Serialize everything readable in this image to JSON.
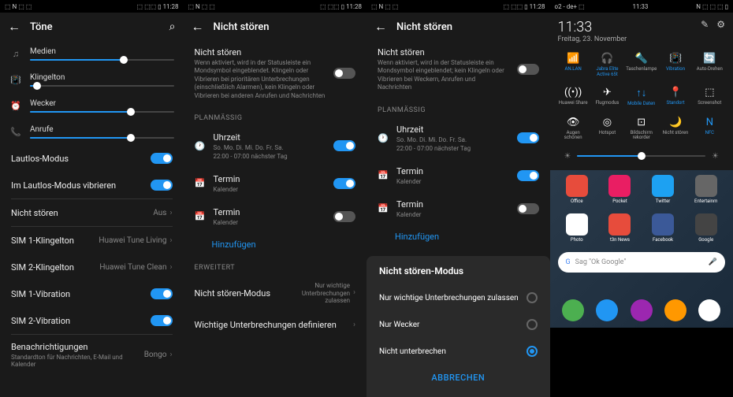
{
  "statusbar": {
    "time": "11:28",
    "left_icons": "⬚ N ⬚ ⬚",
    "right_icons": "⬚ ⬚⬚ ▯"
  },
  "s1": {
    "title": "Töne",
    "sliders": [
      {
        "icon": "♫",
        "label": "Medien",
        "value": 65
      },
      {
        "icon": "📳",
        "label": "Klingelton",
        "value": 5
      },
      {
        "icon": "⏰",
        "label": "Wecker",
        "value": 70
      },
      {
        "icon": "📞",
        "label": "Anrufe",
        "value": 70
      }
    ],
    "rows": [
      {
        "label": "Lautlos-Modus",
        "toggle": true
      },
      {
        "label": "Im Lautlos-Modus vibrieren",
        "toggle": true
      }
    ],
    "dnd": {
      "label": "Nicht stören",
      "value": "Aus"
    },
    "sim_rows": [
      {
        "label": "SIM 1-Klingelton",
        "value": "Huawei Tune Living"
      },
      {
        "label": "SIM 2-Klingelton",
        "value": "Huawei Tune Clean"
      },
      {
        "label": "SIM 1-Vibration",
        "toggle": true
      },
      {
        "label": "SIM 2-Vibration",
        "toggle": true
      }
    ],
    "notif": {
      "label": "Benachrichtigungen",
      "sub": "Standardton für Nachrichten, E-Mail und Kalender",
      "value": "Bongo"
    }
  },
  "s2": {
    "title": "Nicht stören",
    "desc": {
      "title": "Nicht stören",
      "text": "Wenn aktiviert, wird in der Statusleiste ein Mondsymbol eingeblendet. Klingeln oder Vibrieren bei prioritären Unterbrechungen (einschließlich Alarmen), kein Klingeln oder Vibrieren bei anderen Anrufen und Nachrichten"
    },
    "sect_plan": "PLANMÄSSIG",
    "time_row": {
      "label": "Uhrzeit",
      "sub": "So. Mo. Di. Mi. Do. Fr. Sa.",
      "sub2": "22:00 - 07:00 nächster Tag",
      "toggle": true
    },
    "termin1": {
      "label": "Termin",
      "sub": "Kalender",
      "toggle": true
    },
    "termin2": {
      "label": "Termin",
      "sub": "Kalender",
      "toggle": false
    },
    "add": "Hinzufügen",
    "sect_adv": "ERWEITERT",
    "mode": {
      "label": "Nicht stören-Modus",
      "value": "Nur wichtige Unterbrechungen zulassen"
    },
    "define": "Wichtige Unterbrechungen definieren"
  },
  "s3": {
    "title": "Nicht stören",
    "desc": {
      "title": "Nicht stören",
      "text": "Wenn aktiviert, wird in der Statusleiste ein Mondsymbol eingeblendet; kein Klingeln oder Vibrieren bei Weckern, Anrufen und Nachrichten"
    },
    "sect_plan": "PLANMÄSSIG",
    "time_row": {
      "label": "Uhrzeit",
      "sub": "So. Mo. Di. Mi. Do. Fr. Sa.",
      "sub2": "22:00 - 07:00 nächster Tag",
      "toggle": true
    },
    "termin1": {
      "label": "Termin",
      "sub": "Kalender",
      "toggle": true
    },
    "termin2": {
      "label": "Termin",
      "sub": "Kalender",
      "toggle": false
    },
    "add": "Hinzufügen",
    "dialog": {
      "title": "Nicht stören-Modus",
      "opts": [
        {
          "label": "Nur wichtige Unterbrechungen zulassen",
          "sel": false
        },
        {
          "label": "Nur Wecker",
          "sel": false
        },
        {
          "label": "Nicht unterbrechen",
          "sel": true
        }
      ],
      "cancel": "ABBRECHEN"
    }
  },
  "s4": {
    "statusbar": {
      "left": "o2 - de+ ⬚",
      "time": "11:33",
      "right": "N ⬚ ⬚ ⬚ ▯"
    },
    "time": "11:33",
    "date": "Freitag, 23. November",
    "tiles": [
      {
        "ic": "📶",
        "lbl": "AN.LAN",
        "active": true
      },
      {
        "ic": "🎧",
        "lbl": "Jabra Elite Active 65t",
        "active": true
      },
      {
        "ic": "🔦",
        "lbl": "Taschenlampe",
        "active": false
      },
      {
        "ic": "📳",
        "lbl": "Vibration",
        "active": true
      },
      {
        "ic": "🔄",
        "lbl": "Auto-Drehen",
        "active": false
      },
      {
        "ic": "((•))",
        "lbl": "Huawei Share",
        "active": false
      },
      {
        "ic": "✈",
        "lbl": "Flugmodus",
        "active": false
      },
      {
        "ic": "↑↓",
        "lbl": "Mobile Daten",
        "active": true
      },
      {
        "ic": "📍",
        "lbl": "Standort",
        "active": true
      },
      {
        "ic": "⬚",
        "lbl": "Screenshot",
        "active": false
      },
      {
        "ic": "👁",
        "lbl": "Augen schonen",
        "active": false
      },
      {
        "ic": "◎",
        "lbl": "Hotspot",
        "active": false
      },
      {
        "ic": "⊡",
        "lbl": "Bildschirm rekorder",
        "active": false
      },
      {
        "ic": "🌙",
        "lbl": "Nicht stören",
        "active": false
      },
      {
        "ic": "N",
        "lbl": "NFC",
        "active": true
      }
    ],
    "brightness": 50,
    "apps_row1": [
      {
        "lbl": "Office",
        "bg": "#e74c3c"
      },
      {
        "lbl": "Pocket",
        "bg": "#e91e63"
      },
      {
        "lbl": "Twitter",
        "bg": "#1da1f2"
      },
      {
        "lbl": "Entertainm",
        "bg": "#666"
      }
    ],
    "apps_row2": [
      {
        "lbl": "Photo",
        "bg": "#fff"
      },
      {
        "lbl": "t3n News",
        "bg": "#e74c3c"
      },
      {
        "lbl": "Facebook",
        "bg": "#3b5998"
      },
      {
        "lbl": "Google",
        "bg": "#444"
      }
    ],
    "search": "Sag \"Ok Google\"",
    "dock": [
      {
        "bg": "#4caf50"
      },
      {
        "bg": "#2196f3"
      },
      {
        "bg": "#9c27b0"
      },
      {
        "bg": "#ff9800"
      },
      {
        "bg": "#fff"
      }
    ]
  }
}
